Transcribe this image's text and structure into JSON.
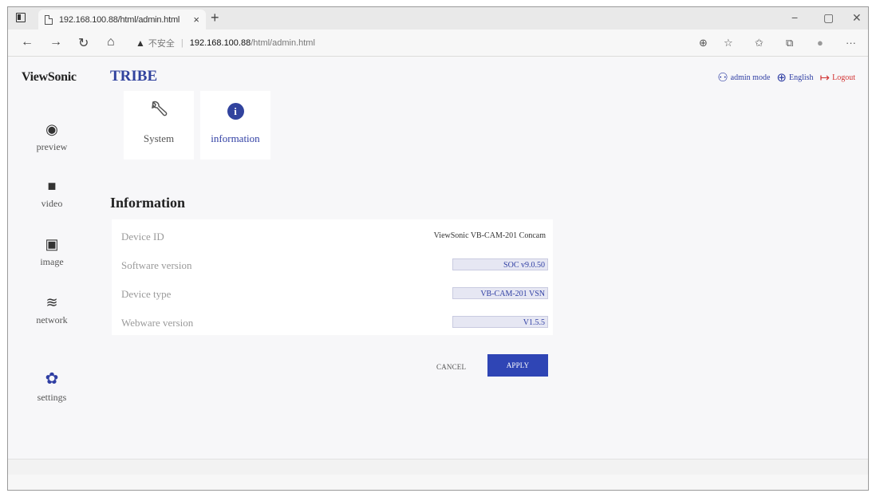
{
  "browser": {
    "tab_title": "192.168.100.88/html/admin.html",
    "tab_close": "×",
    "new_tab": "+",
    "window_controls": {
      "minimize": "−",
      "restore": "▢",
      "close": "✕"
    },
    "nav": {
      "back": "←",
      "forward": "→",
      "refresh": "↻",
      "home": "⌂"
    },
    "address": {
      "warning_icon": "▲",
      "security_label": "不安全",
      "separator": "|",
      "host": "192.168.100.88",
      "path": "/html/admin.html"
    },
    "toolbar_icons": [
      "zoom-icon",
      "favorite-add-icon",
      "favorites-icon",
      "collections-icon",
      "profile-icon",
      "more-icon"
    ],
    "toolbar_glyphs": {
      "zoom": "⊕",
      "favorite_add": "☆",
      "favorites": "✩",
      "collections": "⧉",
      "profile": "●",
      "more": "···"
    }
  },
  "app": {
    "logo": "ViewSonic",
    "title": "TRIBE",
    "accent_color": "#31439e",
    "top_right": {
      "admin_mode": "admin mode",
      "language": "English",
      "logout": "Logout"
    },
    "sidebar": [
      {
        "label": "preview",
        "icon": "eye-icon",
        "glyph": "◉"
      },
      {
        "label": "video",
        "icon": "video-camera-icon",
        "glyph": "■"
      },
      {
        "label": "image",
        "icon": "image-icon",
        "glyph": "▣"
      },
      {
        "label": "network",
        "icon": "wifi-icon",
        "glyph": "≋"
      },
      {
        "label": "settings",
        "icon": "gear-icon",
        "glyph": "✿",
        "active": true
      }
    ],
    "settings_tabs": [
      {
        "label": "System",
        "icon": "wrench-icon",
        "glyph": "🔧"
      },
      {
        "label": "information",
        "icon": "info-icon",
        "glyph": "i",
        "active": true
      }
    ],
    "section_title": "Information",
    "info_rows": [
      {
        "label": "Device ID",
        "value": "ViewSonic VB-CAM-201 Concam"
      },
      {
        "label": "Software version",
        "value": "SOC v9.0.50"
      },
      {
        "label": "Device type",
        "value": "VB-CAM-201 VSN"
      },
      {
        "label": "Webware version",
        "value": "V1.5.5"
      }
    ],
    "buttons": {
      "cancel": "CANCEL",
      "apply": "APPLY"
    }
  }
}
